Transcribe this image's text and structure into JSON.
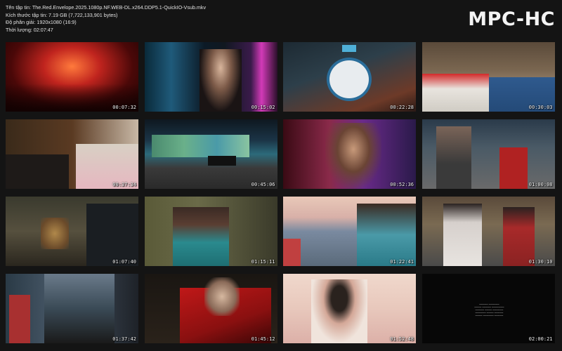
{
  "file_info": {
    "line1": "Tên tập tin: The.Red.Envelope.2025.1080p.NF.WEB-DL.x264.DDP5.1-QuickIO-Vsub.mkv",
    "line2": "Kích thước tập tin: 7.19 GB (7,722,133,901 bytes)",
    "line3": "Độ phân giải: 1920x1080 (16:9)",
    "line4": "Thời lượng: 02:07:47"
  },
  "logo": "MPC-HC",
  "thumbnails": [
    {
      "time": "00:07:32"
    },
    {
      "time": "00:15:02"
    },
    {
      "time": "00:22:28"
    },
    {
      "time": "00:30:03"
    },
    {
      "time": "00:37:34"
    },
    {
      "time": "00:45:06"
    },
    {
      "time": "00:52:36"
    },
    {
      "time": "01:00:08"
    },
    {
      "time": "01:07:40"
    },
    {
      "time": "01:15:11"
    },
    {
      "time": "01:22:41"
    },
    {
      "time": "01:30:10"
    },
    {
      "time": "01:37:42"
    },
    {
      "time": "01:45:12"
    },
    {
      "time": "01:52:48"
    },
    {
      "time": "02:00:21"
    }
  ]
}
